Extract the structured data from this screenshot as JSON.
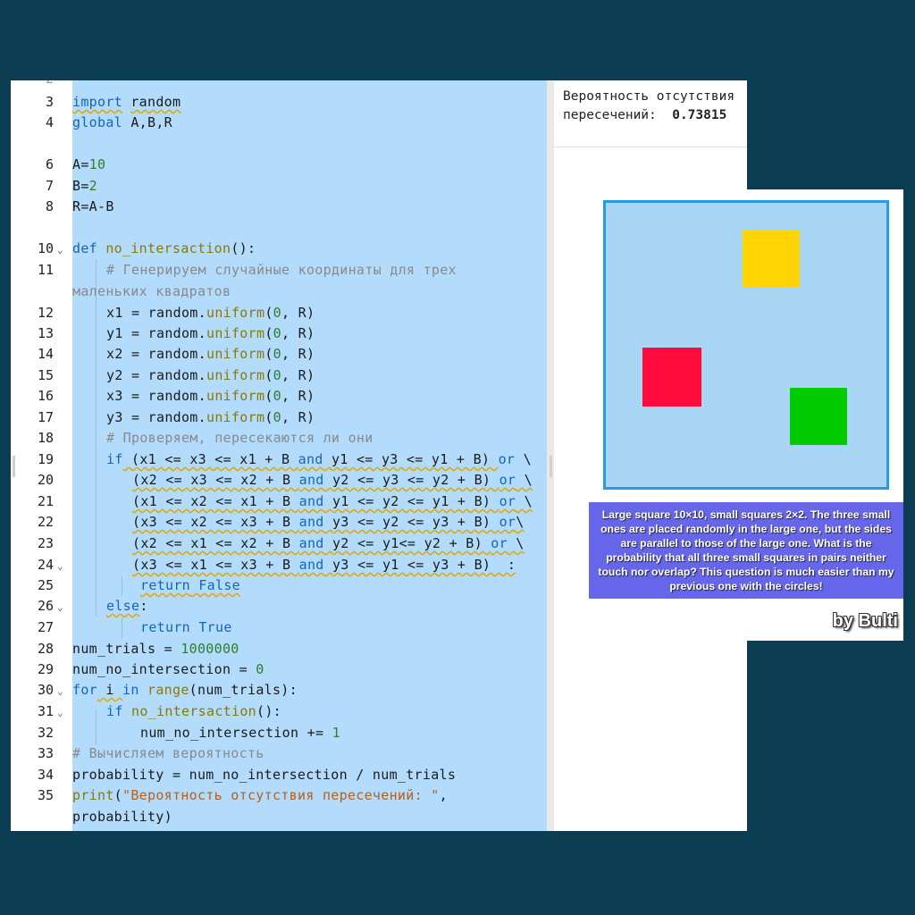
{
  "editor": {
    "partial_top_line_number": "2",
    "line_numbers": [
      "3",
      "4",
      "6",
      "7",
      "8",
      "10",
      "11",
      "12",
      "13",
      "14",
      "15",
      "16",
      "17",
      "18",
      "19",
      "20",
      "21",
      "22",
      "23",
      "24",
      "25",
      "26",
      "27",
      "28",
      "29",
      "30",
      "31",
      "32",
      "33",
      "34",
      "35"
    ],
    "code": {
      "import_kw": "import",
      "import_mod": "random",
      "global_kw": "global",
      "global_vars": " A,B,R",
      "a_assign": "A=",
      "a_val": "10",
      "b_assign": "B=",
      "b_val": "2",
      "r_assign": "R=A-B",
      "def_kw": "def",
      "func_name": "no_intersaction",
      "def_tail": "():",
      "comment1_a": "# Генерируем случайные координаты для трех",
      "comment1_b": "маленьких квадратов",
      "var_x1": "x1 = random.",
      "var_y1": "y1 = random.",
      "var_x2": "x2 = random.",
      "var_y2": "y2 = random.",
      "var_x3": "x3 = random.",
      "var_y3": "y3 = random.",
      "uniform": "uniform",
      "paren_open": "(",
      "zero": "0",
      "uniform_tail": ", R)",
      "comment2": "# Проверяем, пересекаются ли они",
      "if_kw": "if",
      "cond1_a": " (x1 <= x3 <= x1 + B ",
      "cond1_b": " y1 <= y3 <= y1 + B) ",
      "cond2_a": "(x2 <= x3 <= x2 + B ",
      "cond2_b": " y2 <= y3 <= y2 + B) ",
      "cond3_a": "(x1 <= x2 <= x1 + B ",
      "cond3_b": " y1 <= y2 <= y1 + B) ",
      "cond4_a": "(x3 <= x2 <= x3 + B ",
      "cond4_b": " y3 <= y2 <= y3 + B) ",
      "cond5_a": "(x2 <= x1 <= x2 + B ",
      "cond5_b": " y2 <= y1<= y2 + B) ",
      "cond6_a": "(x3 <= x1 <= x3 + B ",
      "cond6_b": " y3 <= y1 <= y3 + B)  :",
      "and_kw": "and",
      "or_kw": "or",
      "or_nospace": "or",
      "backslash": " \\",
      "backslash_tight": "\\",
      "return_kw": "return",
      "false_kw": " False",
      "true_kw": " True",
      "else_kw": "else",
      "colon": ":",
      "num_trials": "num_trials = ",
      "num_trials_val": "1000000",
      "num_no": "num_no_intersection = ",
      "num_no_val": "0",
      "for_kw": "for",
      "for_var": " i ",
      "in_kw": "in",
      "range_fn": "range",
      "for_tail": "(num_trials):",
      "if2_call": "no_intersaction",
      "if2_tail": "():",
      "incr": "num_no_intersection += ",
      "incr_val": "1",
      "comment3": "# Вычисляем вероятность",
      "prob_line": "probability = num_no_intersection / num_trials",
      "print_fn": "print",
      "print_str": "\"Вероятность отсутствия пересечений: \"",
      "print_tail": ",",
      "print_arg": "probability)"
    }
  },
  "output": {
    "line1": "Вероятность отсутствия",
    "line2_label": "пересечений:  ",
    "value": "0.73815"
  },
  "card": {
    "caption": "Large square 10×10, small squares 2×2. The three small ones are placed randomly in the large one, but the sides are parallel to those of the large one. What is the probability that all three small squares in pairs neither touch nor overlap? This question is much easier than my previous one with the circles!",
    "byline": "by Bulti",
    "colors": {
      "yellow": "#ffd400",
      "red": "#ff0a3c",
      "green": "#00cc00",
      "big": "#a9d6f5"
    }
  }
}
